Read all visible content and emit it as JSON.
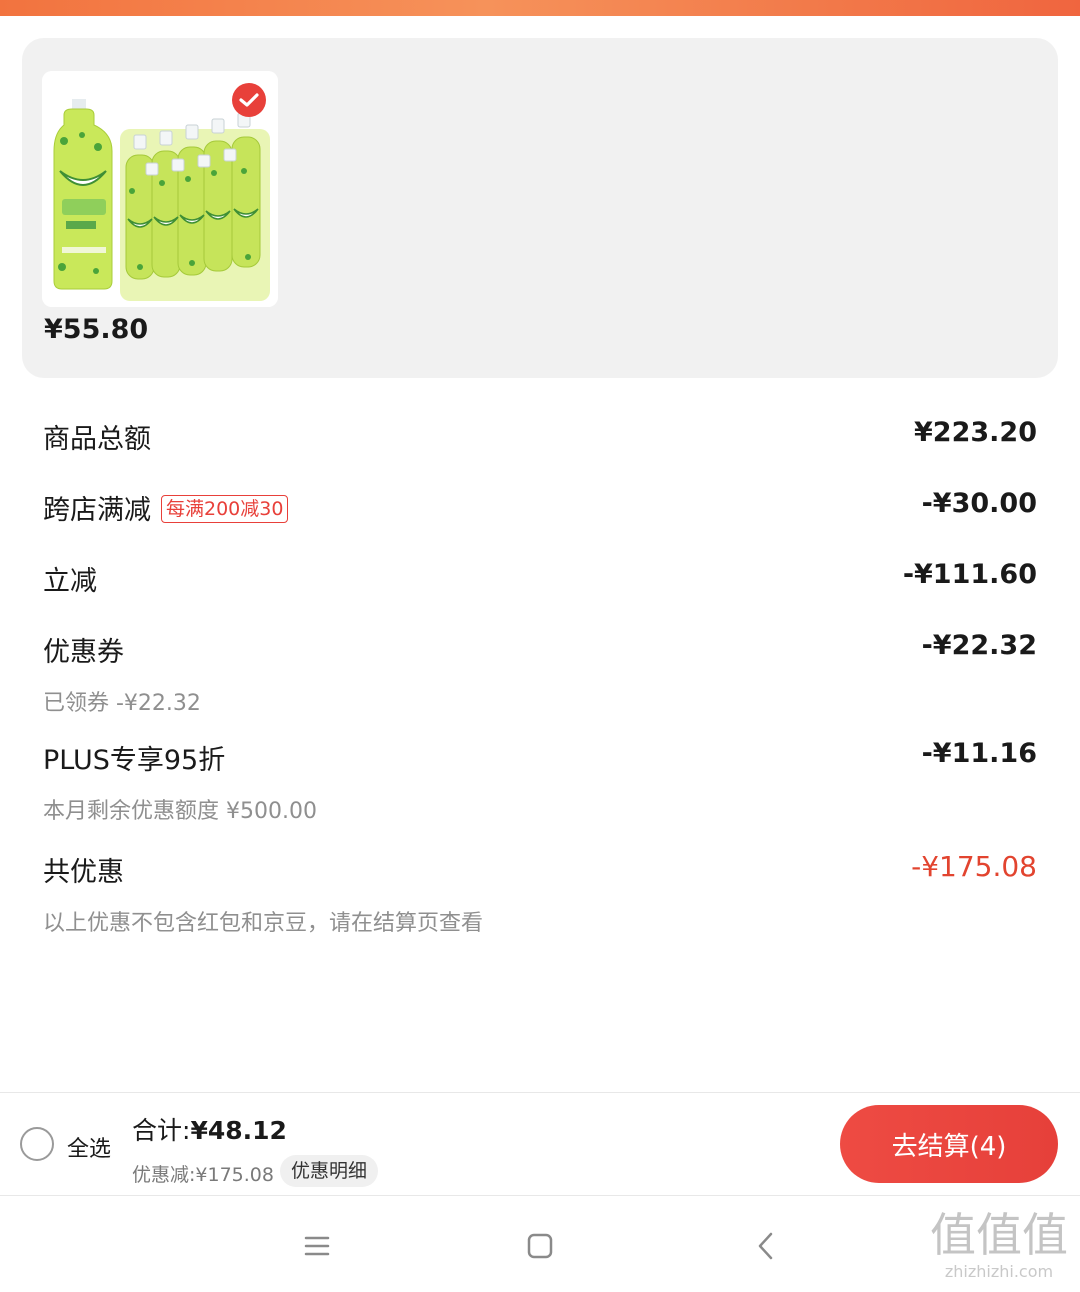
{
  "product": {
    "price": "¥55.80",
    "selected": true,
    "image_desc_icon": "product-image"
  },
  "summary": {
    "goods_total": {
      "label": "商品总额",
      "value": "¥223.20"
    },
    "cross_store": {
      "label": "跨店满减",
      "tag": "每满200减30",
      "value": "-¥30.00"
    },
    "instant_cut": {
      "label": "立减",
      "value": "-¥111.60"
    },
    "coupon": {
      "label": "优惠券",
      "value": "-¥22.32",
      "note": "已领券 -¥22.32"
    },
    "plus": {
      "label": "PLUS专享95折",
      "value": "-¥11.16",
      "note": "本月剩余优惠额度 ¥500.00"
    },
    "total_discount": {
      "label": "共优惠",
      "value": "-¥175.08",
      "note": "以上优惠不包含红包和京豆，请在结算页查看"
    }
  },
  "bottom_bar": {
    "select_all": "全选",
    "total_label": "合计:",
    "total_value": "¥48.12",
    "discount_text": "优惠减:¥175.08",
    "detail_button": "优惠明细",
    "checkout_button": "去结算(4)"
  },
  "watermark": {
    "logo": "值值值",
    "url": "zhizhizhi.com"
  },
  "colors": {
    "accent": "#e8403a",
    "discount_red": "#e2442f",
    "card_bg": "#f1f1f1"
  }
}
